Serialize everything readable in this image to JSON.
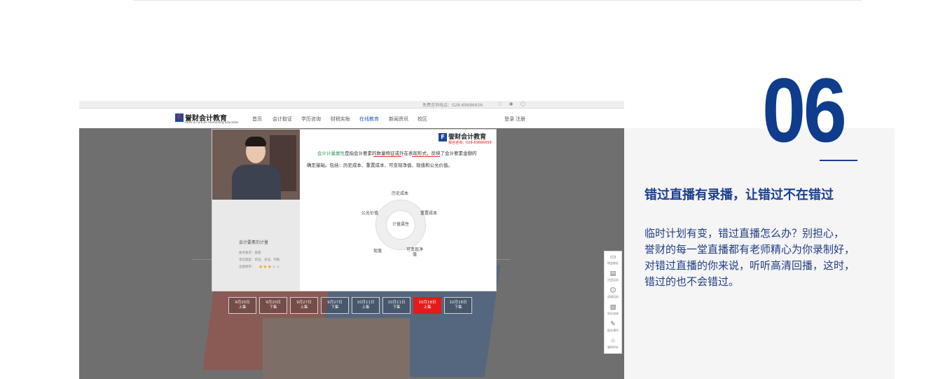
{
  "headline": "错过直播有录播，让错过不在错过",
  "big_number": "06",
  "description_lines": [
    "临时计划有变，错过直播怎么办？别担心，",
    "誉财的每一堂直播都有老师精心为你录制好，",
    "对错过直播的你来说，听听高清回播，这时，",
    "错过的也不会错过。"
  ],
  "screenshot": {
    "topbar": {
      "phone": "免费咨询电话：028-69686656"
    },
    "logo": {
      "mark_letter": "F",
      "name": "誉财会计教育",
      "subtitle": "Fame & Fortune Accounting Education"
    },
    "nav": [
      "首页",
      "会计取证",
      "学历咨询",
      "财税实账",
      "在线教育",
      "新闻资讯",
      "校区"
    ],
    "nav_active": "在线教育",
    "login": "登录",
    "register": "注册",
    "video": {
      "slide_brand": {
        "name": "誉财会计教育",
        "phone": "报名咨询：028-69686658"
      },
      "line1_hl": "会计计量属性",
      "line1_rest": "是指会计要素的数量特征或外在表现形式，反映了会计要素金额的",
      "line2": "确定基础。包括：历史成本、重置成本、可变现净值、现值和公允价值。",
      "diagram_center": "计量属性",
      "diagram_labels": [
        "历史成本",
        "重置成本",
        "可变现净值",
        "现值",
        "公允价值"
      ],
      "course_title": "会计要素的计量",
      "course_lines": [
        "备考要求：掌握",
        "常见题型：单选、多选、判断",
        "出题频率："
      ],
      "rating": 3,
      "rating_max": 5
    },
    "episodes": [
      {
        "date": "9月20日",
        "part": "上集"
      },
      {
        "date": "9月20日",
        "part": "下集"
      },
      {
        "date": "9月27日",
        "part": "上集"
      },
      {
        "date": "9月27日",
        "part": "下集"
      },
      {
        "date": "10月11日",
        "part": "上集"
      },
      {
        "date": "10月11日",
        "part": "下集"
      },
      {
        "date": "10月18日",
        "part": "上集"
      },
      {
        "date": "10月18日",
        "part": "下集"
      }
    ],
    "active_episode": 6,
    "sidebar": [
      {
        "icon": "chat-icon",
        "label": "财会取证"
      },
      {
        "icon": "document-icon",
        "label": "注会培训"
      },
      {
        "icon": "person-icon",
        "label": "实账培训"
      },
      {
        "icon": "clipboard-icon",
        "label": "学历咨询"
      },
      {
        "icon": "edit-icon",
        "label": "报名预约"
      },
      {
        "icon": "star-icon",
        "label": "誉财评价"
      }
    ]
  }
}
